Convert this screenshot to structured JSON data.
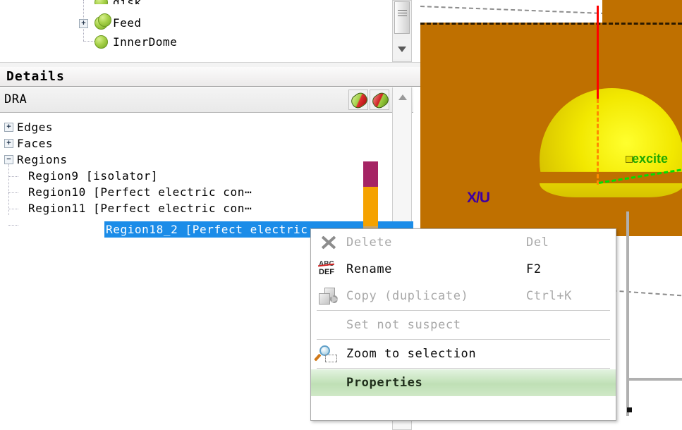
{
  "tree": {
    "nodes": [
      {
        "label": "disk",
        "icon": "green-sphere-icon",
        "expandable": false,
        "clipped": true
      },
      {
        "label": "Feed",
        "icon": "green-sphere-double-icon",
        "expandable": true,
        "clipped": false
      },
      {
        "label": "InnerDome",
        "icon": "green-sphere-icon",
        "expandable": false,
        "clipped": false
      }
    ]
  },
  "details": {
    "title": "Details",
    "object_name": "DRA",
    "toolbar_buttons": [
      {
        "name": "pill-green-red-icon"
      },
      {
        "name": "pill-red-green-icon"
      }
    ],
    "rows": [
      {
        "label": "Edges",
        "expander": "+",
        "depth": 0
      },
      {
        "label": "Faces",
        "expander": "+",
        "depth": 0
      },
      {
        "label": "Regions",
        "expander": "-",
        "depth": 0
      }
    ],
    "region_items": [
      {
        "label": "Region9 [isolator]",
        "selected": false
      },
      {
        "label": "Region10 [Perfect electric con⋯",
        "selected": false
      },
      {
        "label": "Region11 [Perfect electric con⋯",
        "selected": false
      },
      {
        "label": "Region18_2 [Perfect electric",
        "selected": true
      }
    ],
    "selection_color": "#1b8ce8"
  },
  "context_menu": {
    "items": [
      {
        "label": "Delete",
        "accel": "Del",
        "icon": "delete-x-icon",
        "enabled": false,
        "highlighted": false
      },
      {
        "label": "Rename",
        "accel": "F2",
        "icon": "rename-abc-def-icon",
        "enabled": true,
        "highlighted": false
      },
      {
        "label": "Copy (duplicate)",
        "accel": "Ctrl+K",
        "icon": "copy-cubes-icon",
        "enabled": false,
        "highlighted": false
      },
      {
        "label": "Set not suspect",
        "accel": "",
        "icon": "",
        "enabled": false,
        "highlighted": false
      },
      {
        "label": "Zoom to selection",
        "accel": "",
        "icon": "zoom-magnifier-icon",
        "enabled": true,
        "highlighted": false
      },
      {
        "label": "Properties",
        "accel": "",
        "icon": "",
        "enabled": true,
        "highlighted": true
      }
    ],
    "highlight_color": "#bfe0b5"
  },
  "viewport": {
    "axis_labels": {
      "x": "X/U",
      "port": "excite"
    },
    "colors": {
      "ground": "#bf7000",
      "dome": "#f2e800",
      "z_axis": "#ff0000",
      "z_axis_dashed": "#ff8c00",
      "y_axis": "#00e000",
      "x_axis": "#3c0090",
      "excite_label": "#1fa800"
    }
  },
  "colorbar": {
    "segments": [
      {
        "color": "#a52464"
      },
      {
        "color": "#f5a200"
      },
      {
        "color": "#c8a46a"
      }
    ]
  }
}
